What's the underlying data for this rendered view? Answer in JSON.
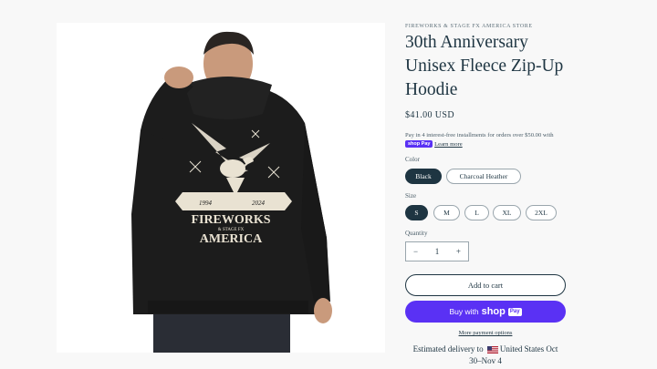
{
  "product_image": {
    "graphic_years": [
      "1994",
      "2024"
    ],
    "graphic_text": [
      "FIREWORKS",
      "& STAGE FX",
      "AMERICA"
    ]
  },
  "product": {
    "vendor": "FIREWORKS & STAGE FX AMERICA STORE",
    "title": "30th Anniversary Unisex Fleece Zip-Up Hoodie",
    "price": "$41.00 USD",
    "installments_text": "Pay in 4 interest-free installments for orders over $50.00 with",
    "shop_pay_badge": "shop Pay",
    "learn_more": "Learn more"
  },
  "options": {
    "color_label": "Color",
    "colors": [
      {
        "label": "Black",
        "selected": true
      },
      {
        "label": "Charcoal Heather",
        "selected": false
      }
    ],
    "size_label": "Size",
    "sizes": [
      {
        "label": "S",
        "selected": true
      },
      {
        "label": "M",
        "selected": false
      },
      {
        "label": "L",
        "selected": false
      },
      {
        "label": "XL",
        "selected": false
      },
      {
        "label": "2XL",
        "selected": false
      }
    ]
  },
  "quantity": {
    "label": "Quantity",
    "value": "1",
    "minus": "−",
    "plus": "+"
  },
  "actions": {
    "add_to_cart": "Add to cart",
    "buy_with": "Buy with",
    "shop_logo": "shop",
    "pay_badge": "Pay",
    "more_payment": "More payment options"
  },
  "delivery": {
    "prefix": "Estimated delivery to",
    "country": "United States",
    "dates_part1": "Oct",
    "dates_part2": "30–Nov 4"
  },
  "colors": {
    "accent": "#1e3542",
    "shop_pay": "#5a31f4",
    "hoodie": "#1c1c1c"
  }
}
